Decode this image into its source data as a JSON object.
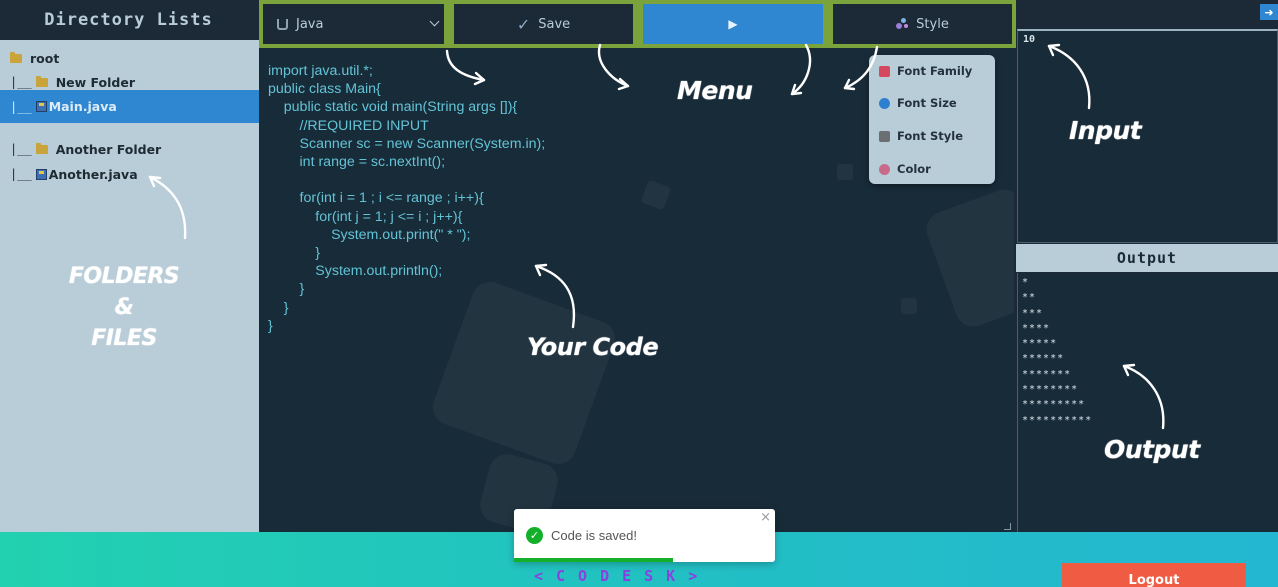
{
  "sidebar": {
    "title": "Directory Lists",
    "items": [
      {
        "prefix": "",
        "type": "folder",
        "label": "root"
      },
      {
        "prefix": "|__",
        "type": "folder",
        "label": "New Folder"
      },
      {
        "prefix": "|__",
        "type": "file",
        "label": "Main.java",
        "selected": true
      },
      {
        "prefix": "|__",
        "type": "folder",
        "label": "Another Folder"
      },
      {
        "prefix": "|__",
        "type": "file",
        "label": "Another.java"
      }
    ]
  },
  "toolbar": {
    "language": "Java",
    "save_label": "Save",
    "run_label": "▶",
    "style_label": "Style"
  },
  "style_menu": {
    "items": [
      {
        "label": "Font Family",
        "icon": "font-family-icon",
        "color": "#d5485f"
      },
      {
        "label": "Font Size",
        "icon": "magnifier-icon",
        "color": "#2f7fd0"
      },
      {
        "label": "Font Style",
        "icon": "font-style-icon",
        "color": "#6a6f74"
      },
      {
        "label": "Color",
        "icon": "palette-icon",
        "color": "#c86a8a"
      }
    ]
  },
  "editor": {
    "code": "import java.util.*;\npublic class Main{\n    public static void main(String args []){\n        //REQUIRED INPUT\n        Scanner sc = new Scanner(System.in);\n        int range = sc.nextInt();\n\n        for(int i = 1 ; i <= range ; i++){\n            for(int j = 1; j <= i ; j++){\n                System.out.print(\" * \");\n            }\n            System.out.println();\n        }\n    }\n}"
  },
  "input": {
    "value": "10"
  },
  "output": {
    "title": "Output",
    "value": "*\n**\n***\n****\n*****\n******\n*******\n********\n*********\n**********"
  },
  "toast": {
    "message": "Code is saved!",
    "close": "×"
  },
  "footer": {
    "brand": "<CODESK>",
    "logout_label": "Logout"
  },
  "annotations": {
    "folders_files": [
      "FOLDERS",
      "&",
      "FILES"
    ],
    "your_code": "Your Code",
    "menu": "Menu",
    "input": "Input",
    "output": "Output"
  },
  "colors": {
    "dark_bg": "#1b2a36",
    "sidebar_bg": "#b9cdd9",
    "accent_blue": "#2f86d1",
    "toolbar_green": "#7aa33b",
    "code_text": "#63c3d6",
    "logout": "#f05c43",
    "brand_purple": "#8d3fe0",
    "success": "#14b02c"
  }
}
